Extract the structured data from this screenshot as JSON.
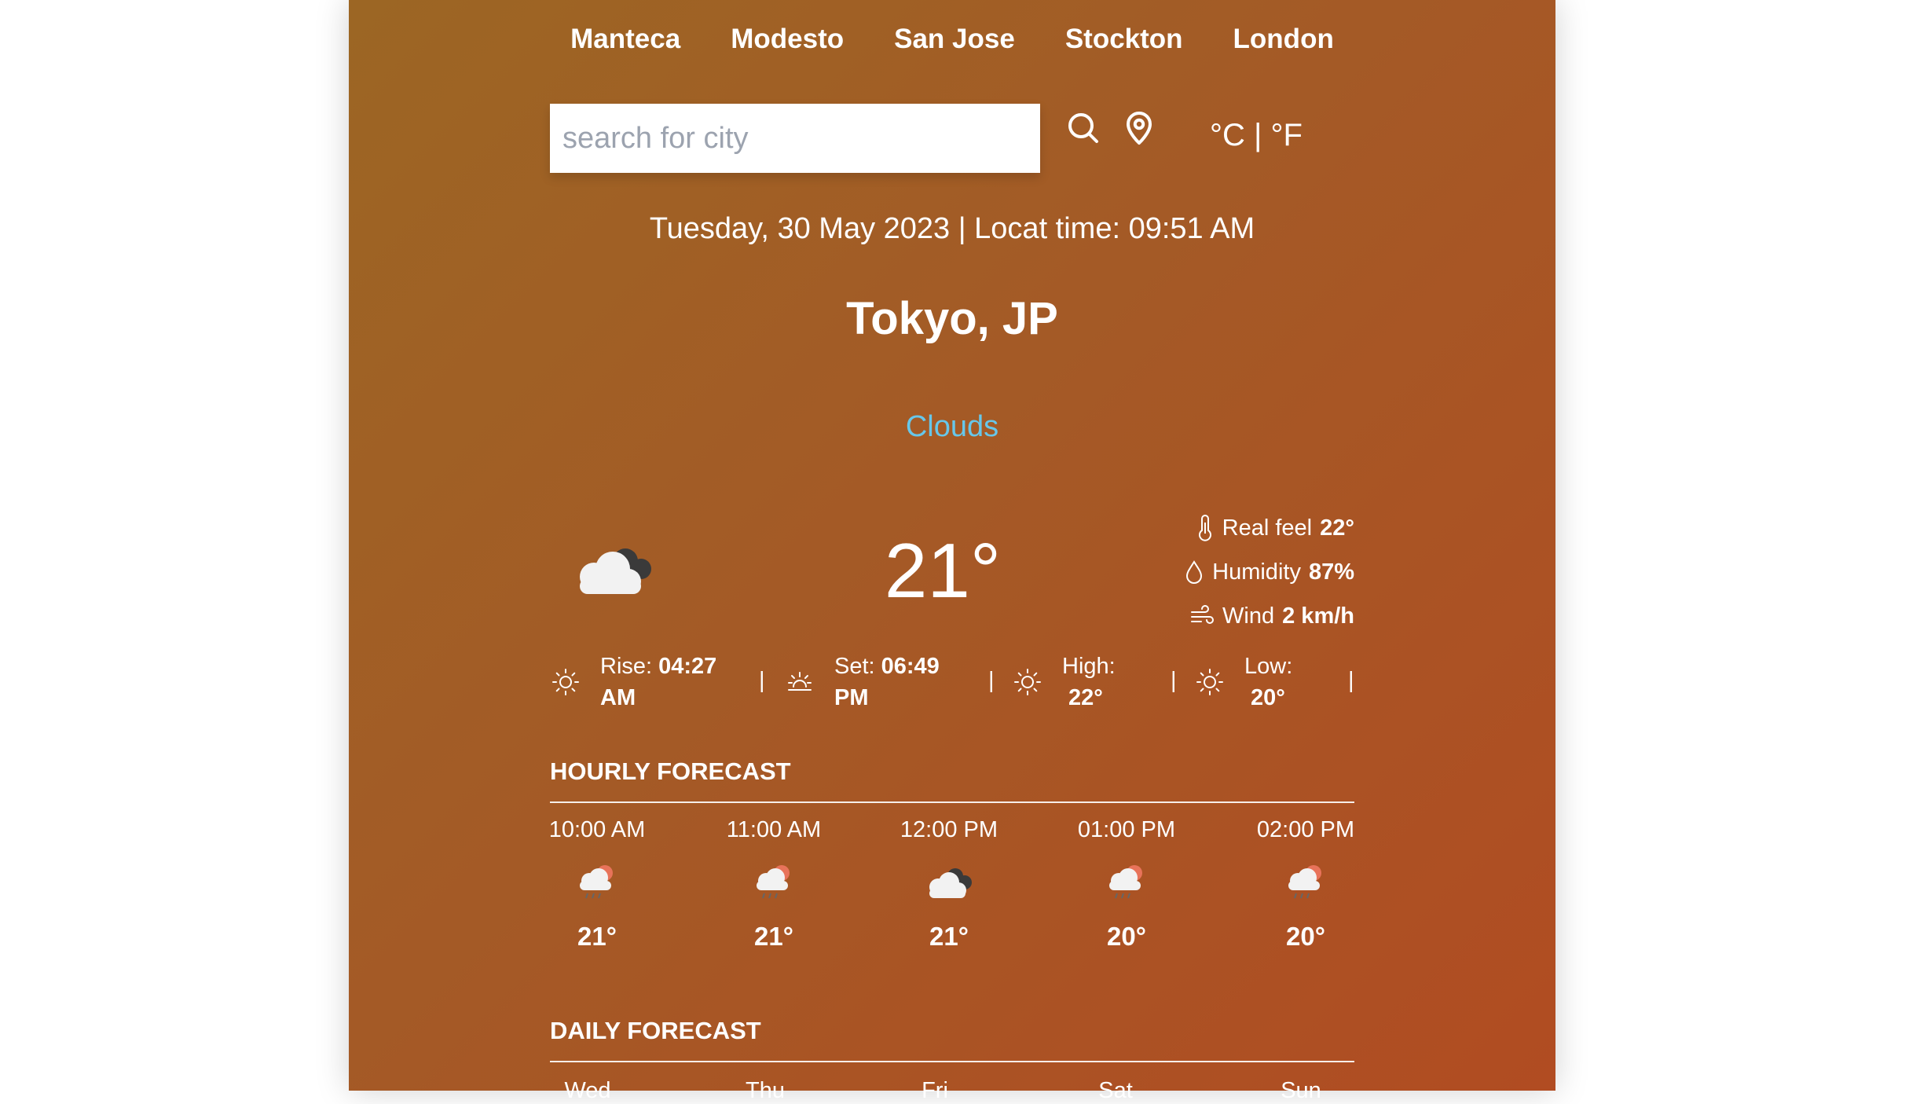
{
  "top_cities": [
    "Manteca",
    "Modesto",
    "San Jose",
    "Stockton",
    "London"
  ],
  "search": {
    "placeholder": "search for city",
    "value": ""
  },
  "units": {
    "celsius": "°C",
    "separator": "|",
    "fahrenheit": "°F"
  },
  "datetime": "Tuesday, 30 May 2023 | Locat time: 09:51 AM",
  "location": "Tokyo, JP",
  "condition": "Clouds",
  "current": {
    "temperature": "21°",
    "real_feel_label": "Real feel",
    "real_feel": "22°",
    "humidity_label": "Humidity",
    "humidity": "87%",
    "wind_label": "Wind",
    "wind": "2 km/h"
  },
  "sun": {
    "rise_label": "Rise:",
    "rise_time": "04:27",
    "rise_period": "AM",
    "set_label": "Set:",
    "set_time": "06:49",
    "set_period": "PM",
    "high_label": "High:",
    "high": "22°",
    "low_label": "Low:",
    "low": "20°",
    "separator": "|"
  },
  "hourly_title": "HOURLY FORECAST",
  "hourly": [
    {
      "time": "10:00 AM",
      "icon": "rain-sun-icon",
      "temp": "21°"
    },
    {
      "time": "11:00 AM",
      "icon": "rain-sun-icon",
      "temp": "21°"
    },
    {
      "time": "12:00 PM",
      "icon": "cloud-icon",
      "temp": "21°"
    },
    {
      "time": "01:00 PM",
      "icon": "rain-sun-icon",
      "temp": "20°"
    },
    {
      "time": "02:00 PM",
      "icon": "rain-sun-icon",
      "temp": "20°"
    }
  ],
  "daily_title": "DAILY FORECAST",
  "daily": [
    "Wed",
    "Thu",
    "Fri",
    "Sat",
    "Sun"
  ],
  "colors": {
    "condition_text": "#67c7ea",
    "gradient_start": "#9c6624",
    "gradient_end": "#b14c22"
  }
}
